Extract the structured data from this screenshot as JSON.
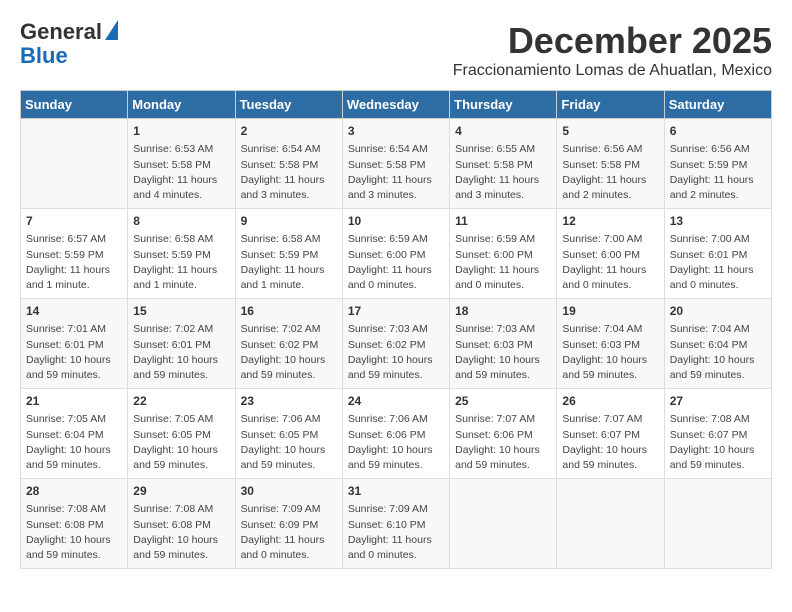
{
  "header": {
    "logo_line1": "General",
    "logo_line2": "Blue",
    "month": "December 2025",
    "location": "Fraccionamiento Lomas de Ahuatlan, Mexico"
  },
  "days_of_week": [
    "Sunday",
    "Monday",
    "Tuesday",
    "Wednesday",
    "Thursday",
    "Friday",
    "Saturday"
  ],
  "weeks": [
    [
      {
        "day": "",
        "content": ""
      },
      {
        "day": "1",
        "content": "Sunrise: 6:53 AM\nSunset: 5:58 PM\nDaylight: 11 hours\nand 4 minutes."
      },
      {
        "day": "2",
        "content": "Sunrise: 6:54 AM\nSunset: 5:58 PM\nDaylight: 11 hours\nand 3 minutes."
      },
      {
        "day": "3",
        "content": "Sunrise: 6:54 AM\nSunset: 5:58 PM\nDaylight: 11 hours\nand 3 minutes."
      },
      {
        "day": "4",
        "content": "Sunrise: 6:55 AM\nSunset: 5:58 PM\nDaylight: 11 hours\nand 3 minutes."
      },
      {
        "day": "5",
        "content": "Sunrise: 6:56 AM\nSunset: 5:58 PM\nDaylight: 11 hours\nand 2 minutes."
      },
      {
        "day": "6",
        "content": "Sunrise: 6:56 AM\nSunset: 5:59 PM\nDaylight: 11 hours\nand 2 minutes."
      }
    ],
    [
      {
        "day": "7",
        "content": "Sunrise: 6:57 AM\nSunset: 5:59 PM\nDaylight: 11 hours\nand 1 minute."
      },
      {
        "day": "8",
        "content": "Sunrise: 6:58 AM\nSunset: 5:59 PM\nDaylight: 11 hours\nand 1 minute."
      },
      {
        "day": "9",
        "content": "Sunrise: 6:58 AM\nSunset: 5:59 PM\nDaylight: 11 hours\nand 1 minute."
      },
      {
        "day": "10",
        "content": "Sunrise: 6:59 AM\nSunset: 6:00 PM\nDaylight: 11 hours\nand 0 minutes."
      },
      {
        "day": "11",
        "content": "Sunrise: 6:59 AM\nSunset: 6:00 PM\nDaylight: 11 hours\nand 0 minutes."
      },
      {
        "day": "12",
        "content": "Sunrise: 7:00 AM\nSunset: 6:00 PM\nDaylight: 11 hours\nand 0 minutes."
      },
      {
        "day": "13",
        "content": "Sunrise: 7:00 AM\nSunset: 6:01 PM\nDaylight: 11 hours\nand 0 minutes."
      }
    ],
    [
      {
        "day": "14",
        "content": "Sunrise: 7:01 AM\nSunset: 6:01 PM\nDaylight: 10 hours\nand 59 minutes."
      },
      {
        "day": "15",
        "content": "Sunrise: 7:02 AM\nSunset: 6:01 PM\nDaylight: 10 hours\nand 59 minutes."
      },
      {
        "day": "16",
        "content": "Sunrise: 7:02 AM\nSunset: 6:02 PM\nDaylight: 10 hours\nand 59 minutes."
      },
      {
        "day": "17",
        "content": "Sunrise: 7:03 AM\nSunset: 6:02 PM\nDaylight: 10 hours\nand 59 minutes."
      },
      {
        "day": "18",
        "content": "Sunrise: 7:03 AM\nSunset: 6:03 PM\nDaylight: 10 hours\nand 59 minutes."
      },
      {
        "day": "19",
        "content": "Sunrise: 7:04 AM\nSunset: 6:03 PM\nDaylight: 10 hours\nand 59 minutes."
      },
      {
        "day": "20",
        "content": "Sunrise: 7:04 AM\nSunset: 6:04 PM\nDaylight: 10 hours\nand 59 minutes."
      }
    ],
    [
      {
        "day": "21",
        "content": "Sunrise: 7:05 AM\nSunset: 6:04 PM\nDaylight: 10 hours\nand 59 minutes."
      },
      {
        "day": "22",
        "content": "Sunrise: 7:05 AM\nSunset: 6:05 PM\nDaylight: 10 hours\nand 59 minutes."
      },
      {
        "day": "23",
        "content": "Sunrise: 7:06 AM\nSunset: 6:05 PM\nDaylight: 10 hours\nand 59 minutes."
      },
      {
        "day": "24",
        "content": "Sunrise: 7:06 AM\nSunset: 6:06 PM\nDaylight: 10 hours\nand 59 minutes."
      },
      {
        "day": "25",
        "content": "Sunrise: 7:07 AM\nSunset: 6:06 PM\nDaylight: 10 hours\nand 59 minutes."
      },
      {
        "day": "26",
        "content": "Sunrise: 7:07 AM\nSunset: 6:07 PM\nDaylight: 10 hours\nand 59 minutes."
      },
      {
        "day": "27",
        "content": "Sunrise: 7:08 AM\nSunset: 6:07 PM\nDaylight: 10 hours\nand 59 minutes."
      }
    ],
    [
      {
        "day": "28",
        "content": "Sunrise: 7:08 AM\nSunset: 6:08 PM\nDaylight: 10 hours\nand 59 minutes."
      },
      {
        "day": "29",
        "content": "Sunrise: 7:08 AM\nSunset: 6:08 PM\nDaylight: 10 hours\nand 59 minutes."
      },
      {
        "day": "30",
        "content": "Sunrise: 7:09 AM\nSunset: 6:09 PM\nDaylight: 11 hours\nand 0 minutes."
      },
      {
        "day": "31",
        "content": "Sunrise: 7:09 AM\nSunset: 6:10 PM\nDaylight: 11 hours\nand 0 minutes."
      },
      {
        "day": "",
        "content": ""
      },
      {
        "day": "",
        "content": ""
      },
      {
        "day": "",
        "content": ""
      }
    ]
  ]
}
